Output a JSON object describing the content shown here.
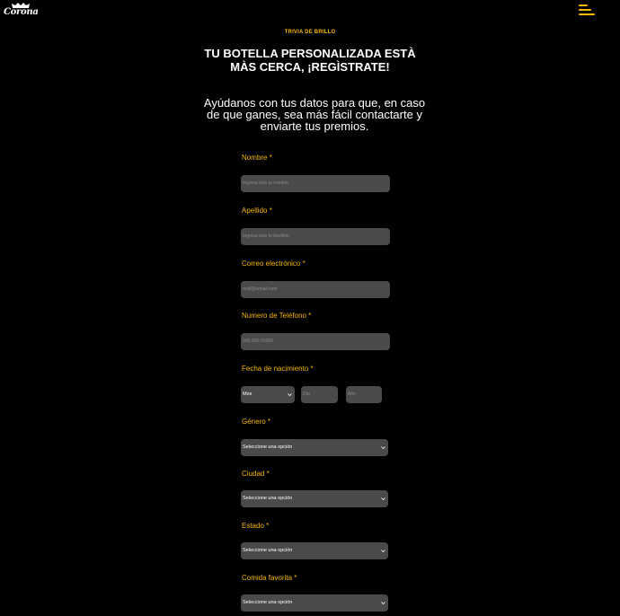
{
  "brand": {
    "name": "Corona"
  },
  "eyebrow": "TRIVIA DE BRILLO",
  "title_line1": "TU BOTELLA PERSONALIZADA ESTÀ",
  "title_line2": "MÀS CERCA, ¡REGÌSTRATE!",
  "subtitle_line1": "Ayúdanos con tus datos para que, en caso",
  "subtitle_line2": "de que ganes, sea más fácil contactarte y",
  "subtitle_line3": "enviarte tus premios.",
  "colors": {
    "accent": "#f5b700",
    "field_bg": "#4a4a4a",
    "background": "#000000"
  },
  "form": {
    "nombre": {
      "label": "Nombre *",
      "placeholder": "Ingresa solo tu nombre"
    },
    "apellido": {
      "label": "Apellido *",
      "placeholder": "Ingresa solo tu Apellido"
    },
    "correo": {
      "label": "Correo electrónico *",
      "placeholder": "mail@tumail.com"
    },
    "telefono": {
      "label": "Numero de Teléfono *",
      "placeholder": "000-000-00000"
    },
    "nacimiento": {
      "label": "Fecha de nacimiento *",
      "mes": "Mes",
      "dia_placeholder": "Día",
      "anio_placeholder": "Año"
    },
    "genero": {
      "label": "Género *",
      "value": "Seleccione una opción"
    },
    "ciudad": {
      "label": "Ciudad *",
      "value": "Seleccione una opción"
    },
    "estado": {
      "label": "Estado *",
      "value": "Seleccione una opción"
    },
    "comida": {
      "label": "Comida favorita *",
      "value": "Seleccione una opción"
    }
  }
}
